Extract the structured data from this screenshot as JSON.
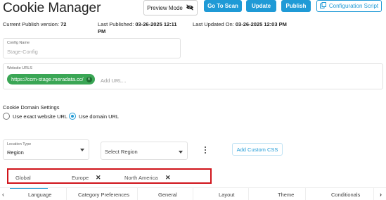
{
  "header": {
    "title": "Cookie Manager",
    "preview_mode_label": "Preview Mode",
    "go_to_scan_label": "Go To Scan",
    "update_label": "Update",
    "publish_label": "Publish",
    "configuration_script_label": "Configuration Script"
  },
  "meta": {
    "current_publish_label": "Current Publish version:",
    "current_publish_value": "72",
    "last_published_label": "Last Published:",
    "last_published_value": "03-26-2025 12:11 PM",
    "last_updated_label": "Last Updated On:",
    "last_updated_value": "03-26-2025 12:03 PM"
  },
  "config": {
    "label": "Config Name",
    "value": "Stage-Config"
  },
  "website_urls": {
    "label": "Website URLS",
    "chip": "https://ccm-stage.meradata.cc/",
    "placeholder": "Add URL..."
  },
  "domain_settings": {
    "title": "Cookie Domain Settings",
    "option_exact": "Use exact website URL",
    "option_domain": "Use domain URL",
    "selected": "Use domain URL"
  },
  "location": {
    "label": "Location Type",
    "value": "Region",
    "region_placeholder": "Select Region",
    "add_css_label": "Add Custom CSS"
  },
  "region_tags": {
    "items": [
      "Global",
      "Europe",
      "North America"
    ]
  },
  "tabs": {
    "items": [
      "Language",
      "Category Preferences",
      "General",
      "Layout",
      "Theme",
      "Conditionals"
    ]
  },
  "colors": {
    "accent": "#1f9ad6",
    "chip": "#3aa655",
    "highlight_border": "#d0141b"
  }
}
